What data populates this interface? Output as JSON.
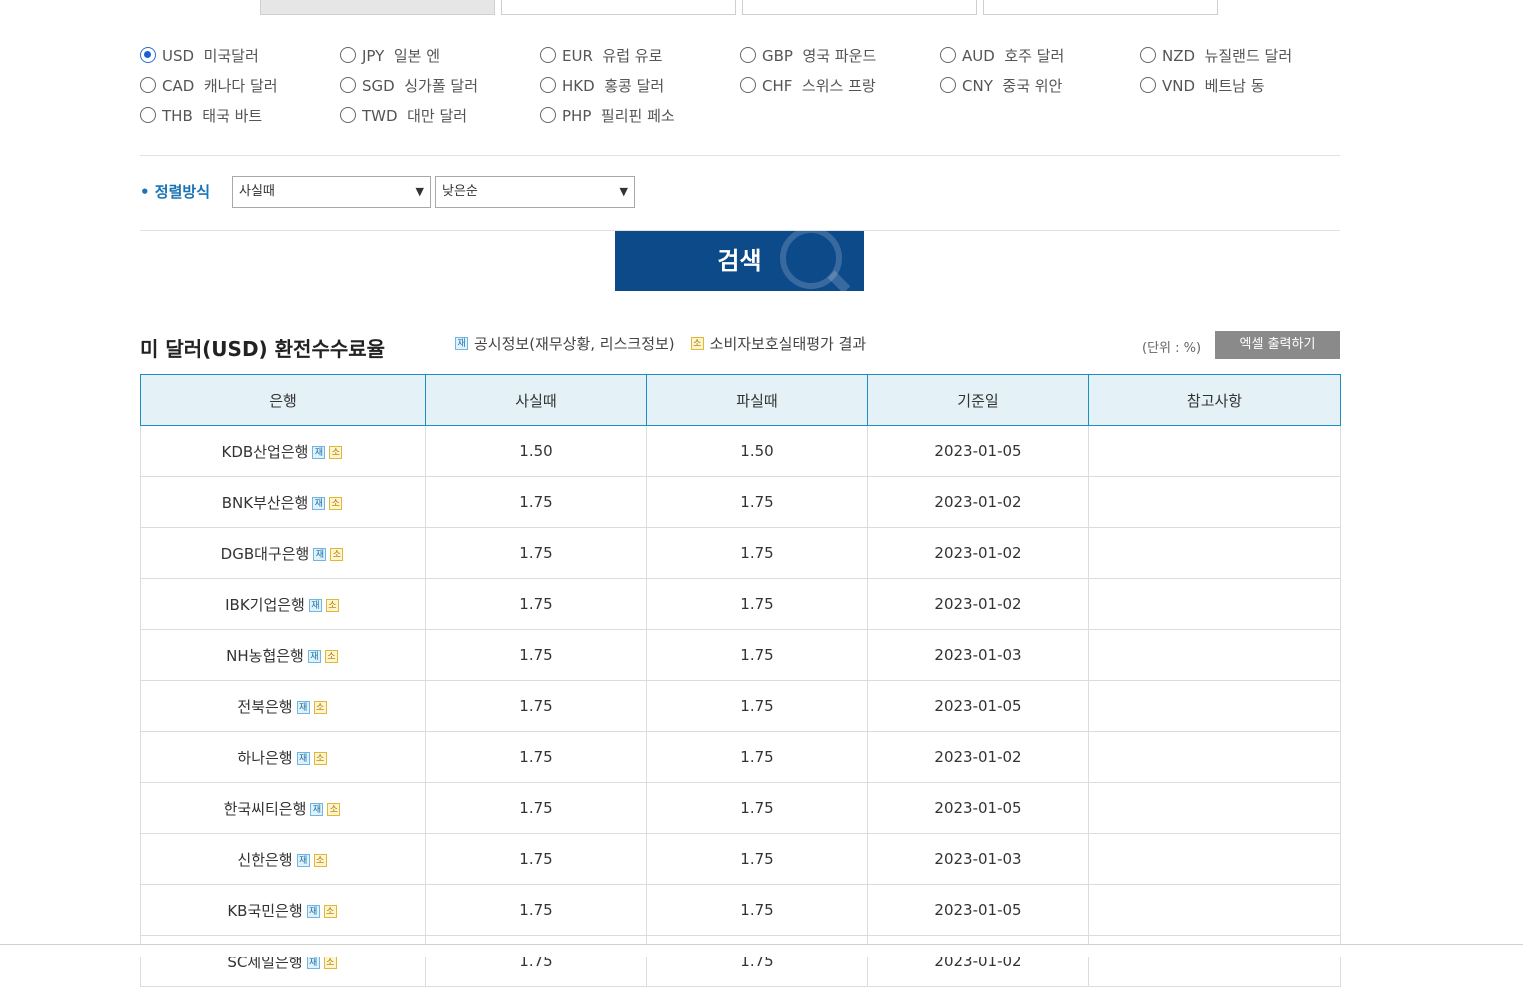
{
  "currencies": [
    {
      "label": "USD  미국달러",
      "checked": true
    },
    {
      "label": "JPY  일본 엔",
      "checked": false
    },
    {
      "label": "EUR  유럽 유로",
      "checked": false
    },
    {
      "label": "GBP  영국 파운드",
      "checked": false
    },
    {
      "label": "AUD  호주 달러",
      "checked": false
    },
    {
      "label": "NZD  뉴질랜드 달러",
      "checked": false
    },
    {
      "label": "CAD  캐나다 달러",
      "checked": false
    },
    {
      "label": "SGD  싱가폴 달러",
      "checked": false
    },
    {
      "label": "HKD  홍콩 달러",
      "checked": false
    },
    {
      "label": "CHF  스위스 프랑",
      "checked": false
    },
    {
      "label": "CNY  중국 위안",
      "checked": false
    },
    {
      "label": "VND  베트남 동",
      "checked": false
    },
    {
      "label": "THB  태국 바트",
      "checked": false
    },
    {
      "label": "TWD  대만 달러",
      "checked": false
    },
    {
      "label": "PHP  필리핀 페소",
      "checked": false
    }
  ],
  "sort": {
    "label": "• 정렬방식",
    "select1": "사실때",
    "select2": "낮은순"
  },
  "search_label": "검색",
  "section": {
    "title": "미 달러(USD) 환전수수료율",
    "legend_jae_badge": "재",
    "legend_jae_text": "공시정보(재무상황, 리스크정보)",
    "legend_so_badge": "소",
    "legend_so_text": "소비자보호실태평가 결과",
    "unit": "(단위 : %)",
    "excel_button": "엑셀 출력하기"
  },
  "table": {
    "headers": [
      "은행",
      "사실때",
      "파실때",
      "기준일",
      "참고사항"
    ],
    "badge_jae": "재",
    "badge_so": "소",
    "rows": [
      {
        "bank": "KDB산업은행",
        "buy": "1.50",
        "sell": "1.50",
        "date": "2023-01-05",
        "note": ""
      },
      {
        "bank": "BNK부산은행",
        "buy": "1.75",
        "sell": "1.75",
        "date": "2023-01-02",
        "note": ""
      },
      {
        "bank": "DGB대구은행",
        "buy": "1.75",
        "sell": "1.75",
        "date": "2023-01-02",
        "note": ""
      },
      {
        "bank": "IBK기업은행",
        "buy": "1.75",
        "sell": "1.75",
        "date": "2023-01-02",
        "note": ""
      },
      {
        "bank": "NH농협은행",
        "buy": "1.75",
        "sell": "1.75",
        "date": "2023-01-03",
        "note": ""
      },
      {
        "bank": "전북은행",
        "buy": "1.75",
        "sell": "1.75",
        "date": "2023-01-05",
        "note": ""
      },
      {
        "bank": "하나은행",
        "buy": "1.75",
        "sell": "1.75",
        "date": "2023-01-02",
        "note": ""
      },
      {
        "bank": "한국씨티은행",
        "buy": "1.75",
        "sell": "1.75",
        "date": "2023-01-05",
        "note": ""
      },
      {
        "bank": "신한은행",
        "buy": "1.75",
        "sell": "1.75",
        "date": "2023-01-03",
        "note": ""
      },
      {
        "bank": "KB국민은행",
        "buy": "1.75",
        "sell": "1.75",
        "date": "2023-01-05",
        "note": ""
      },
      {
        "bank": "SC제일은행",
        "buy": "1.75",
        "sell": "1.75",
        "date": "2023-01-02",
        "note": ""
      }
    ]
  },
  "colors": {
    "primary_button": "#0d4a8a",
    "accent_text": "#1a73b5",
    "header_bg": "#e4f2f8",
    "header_border": "#1b8ec4",
    "excel_button": "#8a8a8a"
  }
}
